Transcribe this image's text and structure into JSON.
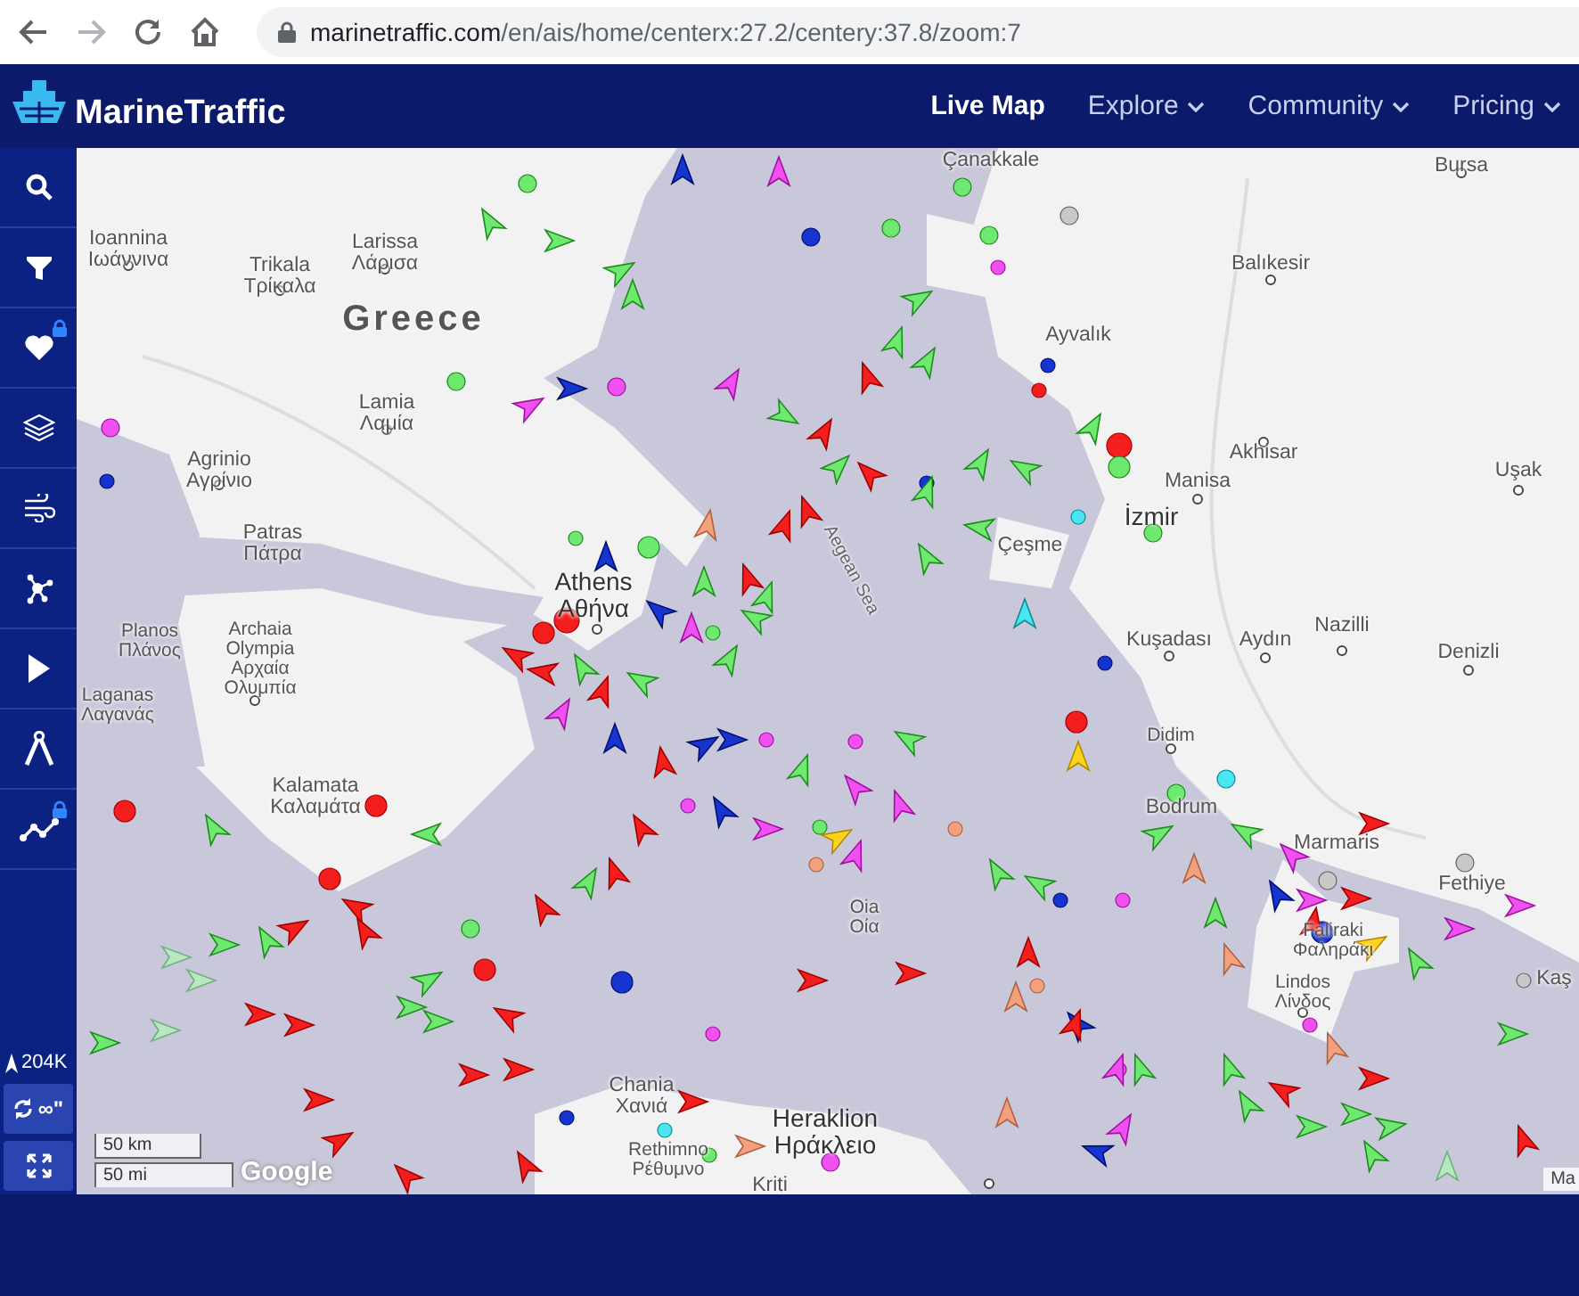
{
  "browser": {
    "url_host": "marinetraffic.com",
    "url_path": "/en/ais/home/centerx:27.2/centery:37.8/zoom:7"
  },
  "header": {
    "brand": "MarineTraffic",
    "nav": [
      {
        "label": "Live Map",
        "selected": true,
        "dropdown": false
      },
      {
        "label": "Explore",
        "selected": false,
        "dropdown": true
      },
      {
        "label": "Community",
        "selected": false,
        "dropdown": true
      },
      {
        "label": "Pricing",
        "selected": false,
        "dropdown": true
      }
    ]
  },
  "sidebar": {
    "tools": [
      {
        "locked": false
      },
      {
        "locked": false
      },
      {
        "locked": true
      },
      {
        "locked": false
      },
      {
        "locked": false
      },
      {
        "locked": false
      },
      {
        "locked": false
      },
      {
        "locked": false
      },
      {
        "locked": true
      }
    ],
    "vessel_count": "204K",
    "playback_label": "∞\""
  },
  "map": {
    "places": [
      {
        "name": "Çanakkale",
        "kind": "city"
      },
      {
        "name": "Bursa",
        "kind": "city"
      },
      {
        "name": "Ioannina",
        "local_name": "Ιωάννινα",
        "kind": "city"
      },
      {
        "name": "Trikala",
        "local_name": "Τρίκαλα",
        "kind": "city"
      },
      {
        "name": "Larissa",
        "local_name": "Λάρισα",
        "kind": "city"
      },
      {
        "name": "Greece",
        "kind": "country"
      },
      {
        "name": "Lamia",
        "local_name": "Λαμία",
        "kind": "city"
      },
      {
        "name": "Agrinio",
        "local_name": "Αγρίνιο",
        "kind": "city"
      },
      {
        "name": "Patras",
        "local_name": "Πάτρα",
        "kind": "city"
      },
      {
        "name": "Athens",
        "local_name": "Αθήνα",
        "kind": "capital"
      },
      {
        "name": "Planos",
        "local_name": "Πλάνος",
        "kind": "town"
      },
      {
        "name": "Archaia Olympia",
        "local_name": "Αρχαία Ολυμπία",
        "kind": "town"
      },
      {
        "name": "Laganas",
        "local_name": "Λαγανάς",
        "kind": "town"
      },
      {
        "name": "Kalamata",
        "local_name": "Καλαμάτα",
        "kind": "city"
      },
      {
        "name": "Aegean Sea",
        "kind": "sea"
      },
      {
        "name": "Balıkesir",
        "kind": "city"
      },
      {
        "name": "Ayvalık",
        "kind": "city"
      },
      {
        "name": "Akhisar",
        "kind": "city"
      },
      {
        "name": "Uşak",
        "kind": "city"
      },
      {
        "name": "Manisa",
        "kind": "city"
      },
      {
        "name": "İzmir",
        "kind": "capital"
      },
      {
        "name": "Çeşme",
        "kind": "city"
      },
      {
        "name": "Kuşadası",
        "kind": "city"
      },
      {
        "name": "Aydın",
        "kind": "city"
      },
      {
        "name": "Nazilli",
        "kind": "city"
      },
      {
        "name": "Denizli",
        "kind": "city"
      },
      {
        "name": "Didim",
        "kind": "town"
      },
      {
        "name": "Bodrum",
        "kind": "city"
      },
      {
        "name": "Oia",
        "local_name": "Οία",
        "kind": "town"
      },
      {
        "name": "Marmaris",
        "kind": "city"
      },
      {
        "name": "Fethiye",
        "kind": "city"
      },
      {
        "name": "Faliraki",
        "local_name": "Φαληράκι",
        "kind": "town"
      },
      {
        "name": "Lindos",
        "local_name": "Λίνδος",
        "kind": "town"
      },
      {
        "name": "Kaş",
        "kind": "city"
      },
      {
        "name": "Chania",
        "local_name": "Χανιά",
        "kind": "city"
      },
      {
        "name": "Rethimno",
        "local_name": "Ρέθυμνο",
        "kind": "town"
      },
      {
        "name": "Heraklion",
        "local_name": "Ηράκλειο",
        "kind": "capital"
      },
      {
        "name": "Kriti",
        "kind": "region"
      }
    ],
    "scale": {
      "metric": "50 km",
      "imperial": "50 mi"
    },
    "logo": "Google",
    "attribution": "Ma"
  }
}
